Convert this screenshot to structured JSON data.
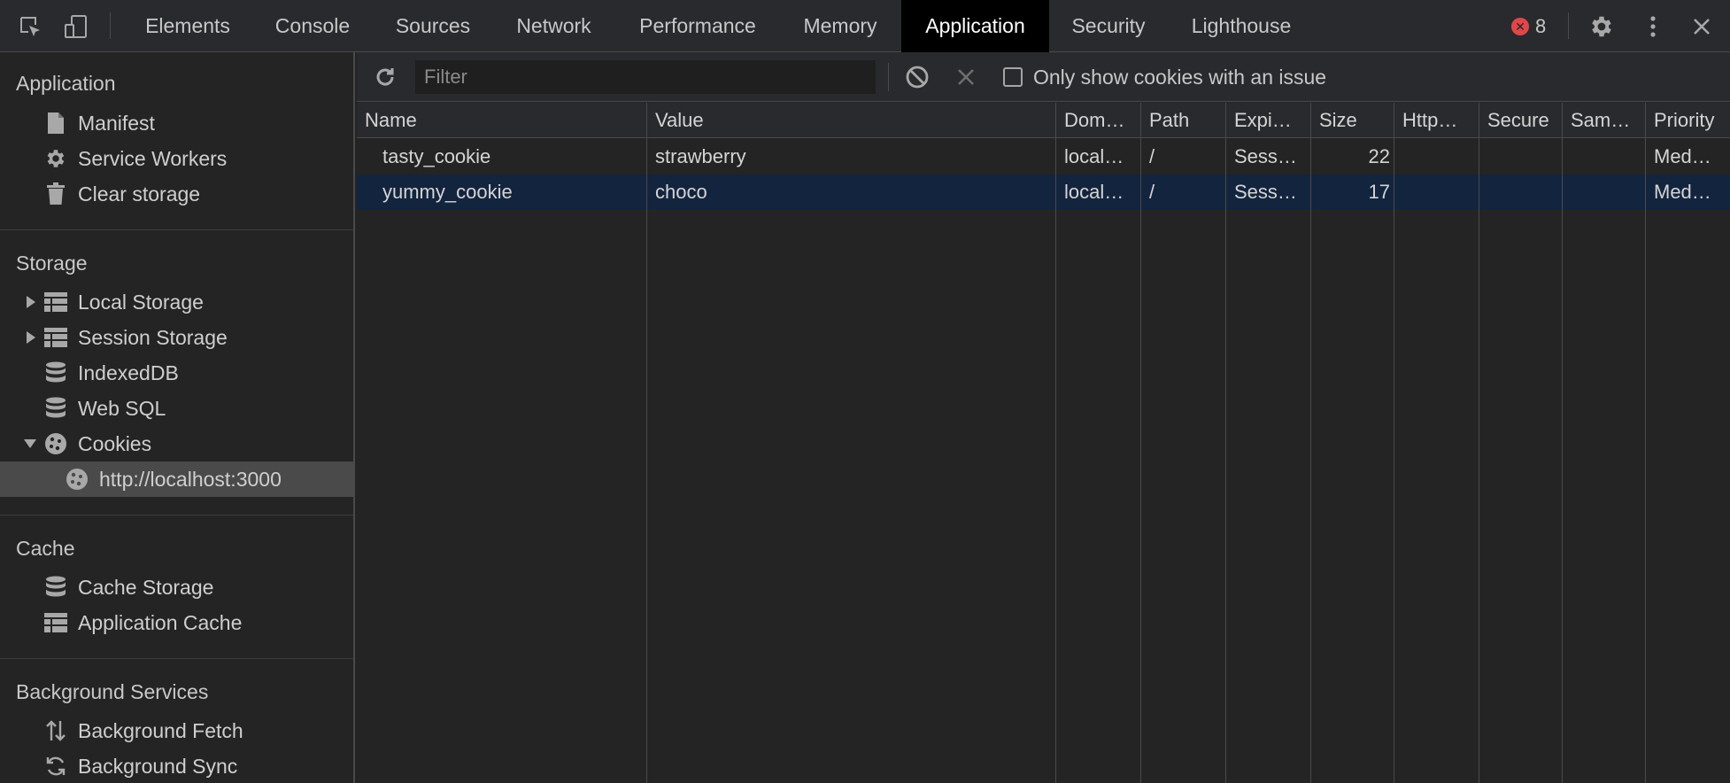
{
  "toolbar": {
    "icons": [
      "inspect-element-icon",
      "device-toolbar-icon"
    ],
    "tabs": [
      {
        "label": "Elements"
      },
      {
        "label": "Console"
      },
      {
        "label": "Sources"
      },
      {
        "label": "Network"
      },
      {
        "label": "Performance"
      },
      {
        "label": "Memory"
      },
      {
        "label": "Application",
        "active": true
      },
      {
        "label": "Security"
      },
      {
        "label": "Lighthouse"
      }
    ],
    "error_count": "8",
    "right_icons": [
      "gear-icon",
      "more-vertical-icon",
      "close-icon"
    ]
  },
  "sidebar": {
    "sections": [
      {
        "title": "Application",
        "items": [
          {
            "label": "Manifest",
            "icon": "document-icon"
          },
          {
            "label": "Service Workers",
            "icon": "gear-icon"
          },
          {
            "label": "Clear storage",
            "icon": "trash-icon"
          }
        ]
      },
      {
        "title": "Storage",
        "items": [
          {
            "label": "Local Storage",
            "icon": "table-icon",
            "expandable": true,
            "expanded": false
          },
          {
            "label": "Session Storage",
            "icon": "table-icon",
            "expandable": true,
            "expanded": false
          },
          {
            "label": "IndexedDB",
            "icon": "database-icon"
          },
          {
            "label": "Web SQL",
            "icon": "database-icon"
          },
          {
            "label": "Cookies",
            "icon": "cookie-icon",
            "expandable": true,
            "expanded": true
          },
          {
            "label": "http://localhost:3000",
            "icon": "cookie-icon",
            "child": true,
            "selected": true
          }
        ]
      },
      {
        "title": "Cache",
        "items": [
          {
            "label": "Cache Storage",
            "icon": "database-icon"
          },
          {
            "label": "Application Cache",
            "icon": "table-icon"
          }
        ]
      },
      {
        "title": "Background Services",
        "items": [
          {
            "label": "Background Fetch",
            "icon": "fetch-arrows-icon"
          },
          {
            "label": "Background Sync",
            "icon": "sync-icon"
          }
        ]
      }
    ]
  },
  "cookies_panel": {
    "filter_placeholder": "Filter",
    "refresh_icon": "refresh-icon",
    "clear_all_icon": "block-icon",
    "delete_selected_icon": "close-icon",
    "only_issues_label": "Only show cookies with an issue",
    "only_issues_checked": false,
    "columns": [
      "Name",
      "Value",
      "Dom…",
      "Path",
      "Expi…",
      "Size",
      "Http…",
      "Secure",
      "Sam…",
      "Priority"
    ],
    "rows": [
      {
        "name": "tasty_cookie",
        "value": "strawberry",
        "domain": "local…",
        "path": "/",
        "expires": "Sess…",
        "size": "22",
        "http": "",
        "secure": "",
        "samesite": "",
        "priority": "Med…",
        "selected": false
      },
      {
        "name": "yummy_cookie",
        "value": "choco",
        "domain": "local…",
        "path": "/",
        "expires": "Sess…",
        "size": "17",
        "http": "",
        "secure": "",
        "samesite": "",
        "priority": "Med…",
        "selected": true
      }
    ]
  },
  "colors": {
    "accent_active_tab": "#000000",
    "selected_row": "#13243f",
    "error": "#e0474a"
  }
}
